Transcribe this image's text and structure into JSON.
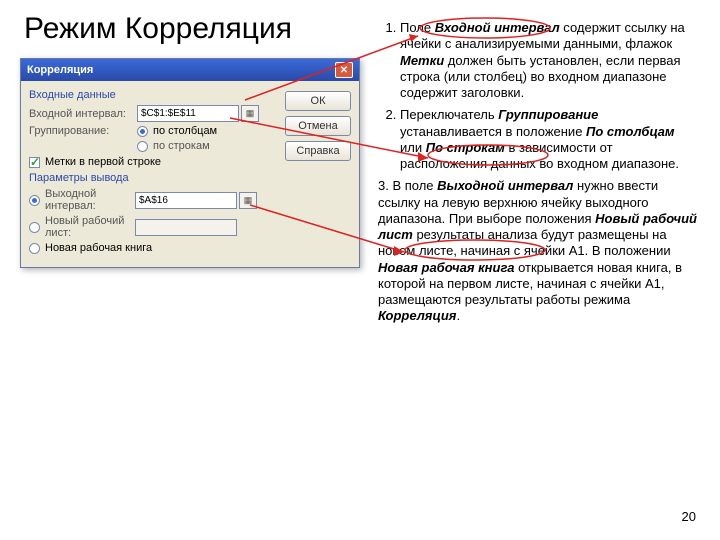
{
  "slide": {
    "title": "Режим Корреляция",
    "page_number": "20"
  },
  "dialog": {
    "title": "Корреляция",
    "close_glyph": "✕",
    "input_section_label": "Входные данные",
    "input_interval_label": "Входной интервал:",
    "input_interval_value": "$C$1:$E$11",
    "cell_picker_glyph": "▦",
    "grouping_label": "Группирование:",
    "grouping_columns": "по столбцам",
    "grouping_rows": "по строкам",
    "labels_first_row": "Метки в первой строке",
    "output_section_label": "Параметры вывода",
    "output_interval_label": "Выходной интервал:",
    "output_interval_value": "$A$16",
    "new_sheet_label": "Новый рабочий лист:",
    "new_book_label": "Новая рабочая книга",
    "buttons": {
      "ok": "ОК",
      "cancel": "Отмена",
      "help": "Справка"
    }
  },
  "text": {
    "item1_a": "Поле ",
    "item1_b": "Входной интервал",
    "item1_c": " содержит ссылку на ячейки с анализируемыми данными, флажок ",
    "item1_d": "Метки",
    "item1_e": " должен быть установлен, если первая строка (или столбец) во входном диапазоне содержит заголовки.",
    "item2_a": "Переключатель ",
    "item2_b": "Группирование",
    "item2_c": " устанавливается в положение ",
    "item2_d": "По столбцам",
    "item2_e": " или ",
    "item2_f": "По строкам",
    "item2_g": " в зависимости от расположения данных во входном диапазоне.",
    "item3_a": "3. В поле ",
    "item3_b": "Выходной интервал",
    "item3_c": " нужно ввести ссылку на левую верхнюю ячейку выходного диапазона. При выборе положения ",
    "item3_d": "Новый рабочий лист",
    "item3_e": " результаты анализа будут размещены на новом листе, начиная с ячейки A1. В положении ",
    "item3_f": "Новая рабочая книга",
    "item3_g": " открывается новая книга, в которой на первом листе, начиная с ячейки A1, размещаются результаты работы режима ",
    "item3_h": "Корреляция",
    "item3_i": "."
  }
}
